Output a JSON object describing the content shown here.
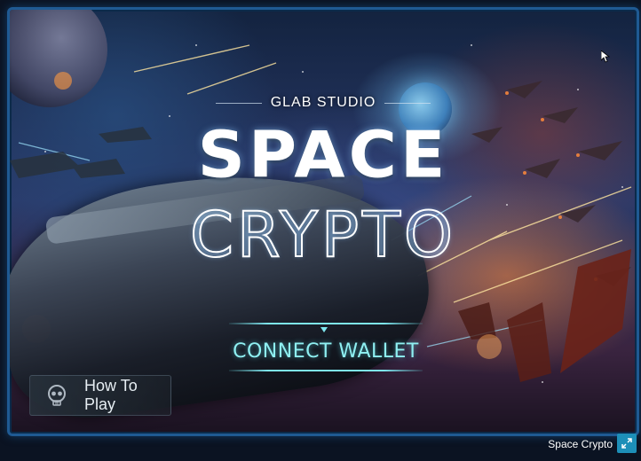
{
  "game": {
    "studio": "GLAB STUDIO",
    "title_line1": "SPACE",
    "title_line2": "CRYPTO",
    "connect_wallet_label": "CONNECT WALLET",
    "how_to_play_label": "How To Play"
  },
  "footer": {
    "title": "Space Crypto"
  },
  "icons": {
    "how_to_play": "skull-icon",
    "fullscreen": "expand-icon",
    "pointer": "mouse-cursor-icon"
  },
  "colors": {
    "accent": "#8ff0f2",
    "frame_border": "#1f5a93",
    "fullscreen_button": "#1d8fb8"
  }
}
